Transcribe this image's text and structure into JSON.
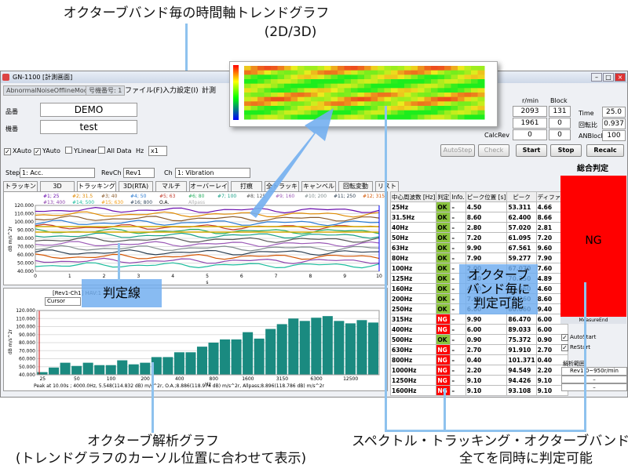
{
  "captions": {
    "trend_line1": "オクターブバンド毎の時間軸トレンドグラフ",
    "trend_line2": "(2D/3D)",
    "analysis_line1": "オクターブ解析グラフ",
    "analysis_line2": "(トレンドグラフのカーソル位置に合わせて表示)",
    "all_line1": "スペクトル・トラッキング・オクターブバンドの",
    "all_line2": "全てを同時に判定可能",
    "judge_line": "判定線",
    "octave_call1": "オクターブ",
    "octave_call2": "バンド毎に",
    "octave_call3": "判定可能"
  },
  "window": {
    "title": "GN-1100 [計測画面]",
    "mode_label": "AbnormalNoiseOfflineMode",
    "model_label": "号機番号: 1",
    "menu": [
      "ファイル(F)",
      "入力設定(I)",
      "計測"
    ],
    "min_btn": "–",
    "max_btn": "□",
    "close_btn": "×"
  },
  "info": {
    "hinban_label": "品番",
    "hinban_value": "DEMO",
    "kiban_label": "機番",
    "kiban_value": "test",
    "rpm_label": "r/min",
    "block_label": "Block",
    "rpm1": "2093",
    "block1": "131",
    "rpm2": "1961",
    "block2": "0",
    "calcrev_label": "CalcRev",
    "calcrev1": "0",
    "calcrev2": "0",
    "time_label": "Time",
    "time_value": "25.0",
    "ratio_label": "回転比",
    "ratio_value": "0.937",
    "anblock_label": "ANBlock",
    "anblock_value": "100"
  },
  "toolbar": {
    "xauto": "XAuto",
    "yauto": "YAuto",
    "ylinear": "YLinear",
    "alldata": "All Data",
    "hz_label": "Hz",
    "zoom": "x1",
    "autostep": "AutoStep",
    "check": "Check",
    "start": "Start",
    "stop": "Stop",
    "recalc": "Recalc"
  },
  "selectors": {
    "step_label": "Step",
    "step_value": "1: Acc.",
    "revch_label": "RevCh",
    "revch_value": "Rev1",
    "ch_label": "Ch",
    "ch_value": "1: Vibration"
  },
  "tabs": [
    "トラッキング",
    "3D",
    "トラッキング(RTA)",
    "3D(RTA)",
    "マルチ",
    "オーバーレイ",
    "打痕",
    "全トラッキング",
    "キャンベル",
    "回転変動",
    "リスト"
  ],
  "legend": [
    "#1; 25",
    "#2; 31.5",
    "#3; 40",
    "#4; 50",
    "#5; 63",
    "#6; 80",
    "#7; 100",
    "#8; 125",
    "#9; 160",
    "#10; 200",
    "#11; 250",
    "#12; 315",
    "#13; 400",
    "#14; 500",
    "#15; 630",
    "#16; 800",
    "O.A.",
    "Allpass"
  ],
  "trend": {
    "ylabel": "dB m/s^2r",
    "xlabel": "s",
    "yticks": [
      "120.000",
      "110.000",
      "100.000",
      "90.000",
      "80.000",
      "70.000",
      "60.000",
      "50.000",
      "40.000"
    ],
    "xticks": [
      "0",
      "1",
      "2",
      "3",
      "4",
      "5",
      "6",
      "7",
      "8",
      "9",
      "10"
    ]
  },
  "octave": {
    "cursor_tag": "[Rev1-Ch1] HAV:1",
    "cursor_select": "Cursor",
    "ylabel": "dB m/s^2r",
    "xlabel": "Hz",
    "yticks": [
      "120.000",
      "110.000",
      "100.000",
      "90.000",
      "80.000",
      "70.000",
      "60.000",
      "50.000",
      "40.000"
    ],
    "xticks": [
      "25",
      "50",
      "100",
      "200",
      "400",
      "800",
      "1600",
      "3150",
      "6300",
      "12500"
    ],
    "status": "Peak at 10.00s ; 4000.0Hz, 5.548(114.832 dB) m/s^2r, O.A.;8.886(118.974 dB) m/s^2r, Allpass;8.896(118.786 dB) m/s^2r"
  },
  "chart_data": {
    "type": "bar",
    "categories": [
      "25",
      "31.5",
      "40",
      "50",
      "63",
      "80",
      "100",
      "125",
      "160",
      "200",
      "250",
      "315",
      "400",
      "500",
      "630",
      "800",
      "1000",
      "1250",
      "1600",
      "2000",
      "2500",
      "3150",
      "4000",
      "5000",
      "6300",
      "8000",
      "10000",
      "12500",
      "16000",
      "20000"
    ],
    "values": [
      43.3,
      49,
      55,
      51,
      55,
      52,
      52,
      58,
      53,
      55,
      62,
      62,
      68,
      68,
      75,
      80,
      84,
      84,
      93,
      85,
      97,
      103,
      110,
      107,
      111,
      113,
      107,
      104,
      108,
      105
    ],
    "ylim": [
      40,
      120
    ],
    "xlabel": "Hz",
    "ylabel": "dB m/s^2r"
  },
  "table": {
    "headers": [
      "中心周波数 [Hz]",
      "判定",
      "Info.",
      "ピーク位置 [s]",
      "ピーク",
      "ディファレ"
    ],
    "rows": [
      {
        "f": "25Hz",
        "j": "OK",
        "i": "–",
        "t": "4.50",
        "p": "53.311",
        "d": "4.66"
      },
      {
        "f": "31.5Hz",
        "j": "OK",
        "i": "–",
        "t": "8.60",
        "p": "62.400",
        "d": "8.66"
      },
      {
        "f": "40Hz",
        "j": "OK",
        "i": "–",
        "t": "2.80",
        "p": "57.020",
        "d": "2.81"
      },
      {
        "f": "50Hz",
        "j": "OK",
        "i": "–",
        "t": "7.20",
        "p": "61.095",
        "d": "7.20"
      },
      {
        "f": "63Hz",
        "j": "OK",
        "i": "–",
        "t": "9.90",
        "p": "67.561",
        "d": "9.60"
      },
      {
        "f": "80Hz",
        "j": "OK",
        "i": "–",
        "t": "7.90",
        "p": "59.277",
        "d": "7.90"
      },
      {
        "f": "100Hz",
        "j": "OK",
        "i": "–",
        "t": "2.00",
        "p": "67.070",
        "d": "7.60"
      },
      {
        "f": "125Hz",
        "j": "OK",
        "i": "–",
        "t": "5.40",
        "p": "70.250",
        "d": "4.89"
      },
      {
        "f": "160Hz",
        "j": "OK",
        "i": "–",
        "t": "4.60",
        "p": "72.660",
        "d": "4.60"
      },
      {
        "f": "200Hz",
        "j": "OK",
        "i": "–",
        "t": "7.60",
        "p": "75.260",
        "d": "8.60"
      },
      {
        "f": "250Hz",
        "j": "OK",
        "i": "–",
        "t": "6.00",
        "p": "80.060",
        "d": "9.40"
      },
      {
        "f": "315Hz",
        "j": "NG",
        "i": "–",
        "t": "9.90",
        "p": "86.470",
        "d": "6.00"
      },
      {
        "f": "400Hz",
        "j": "NG",
        "i": "–",
        "t": "6.00",
        "p": "89.033",
        "d": "6.00"
      },
      {
        "f": "500Hz",
        "j": "OK",
        "i": "–",
        "t": "0.90",
        "p": "75.372",
        "d": "0.90"
      },
      {
        "f": "630Hz",
        "j": "NG",
        "i": "–",
        "t": "2.70",
        "p": "91.910",
        "d": "2.70"
      },
      {
        "f": "800Hz",
        "j": "NG",
        "i": "–",
        "t": "0.40",
        "p": "101.371",
        "d": "0.40"
      },
      {
        "f": "1000Hz",
        "j": "NG",
        "i": "–",
        "t": "2.20",
        "p": "94.549",
        "d": "2.20"
      },
      {
        "f": "1250Hz",
        "j": "NG",
        "i": "–",
        "t": "9.10",
        "p": "94.426",
        "d": "9.10"
      },
      {
        "f": "1600Hz",
        "j": "NG",
        "i": "–",
        "t": "9.10",
        "p": "93.108",
        "d": "9.10"
      }
    ]
  },
  "verdict": {
    "title": "総合判定",
    "value": "NG",
    "measure_end": "MeasureEnd",
    "autostart": "AutoStart",
    "restart": "ReStart",
    "range_label": "解析範囲",
    "range_value": "Rev1:0~950r/min",
    "dash1": "–",
    "dash2": "–"
  },
  "colors": {
    "ok": "#8bc53f",
    "ng": "#ff0000",
    "bar": "#1a8a80",
    "callout": "#73aff0"
  }
}
